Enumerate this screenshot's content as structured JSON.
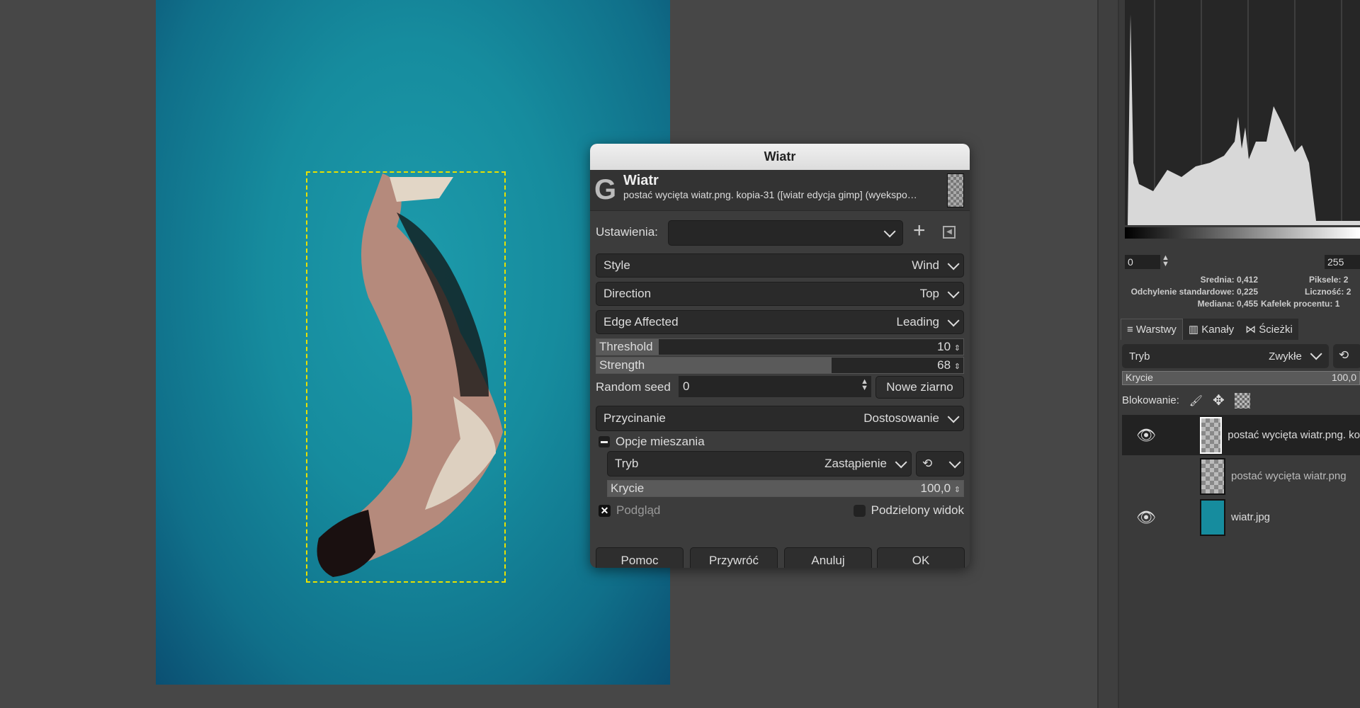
{
  "dialog": {
    "title": "Wiatr",
    "header_title": "Wiatr",
    "header_subtitle": "postać wycięta wiatr.png. kopia-31 ([wiatr edycja gimp] (wyekspo…",
    "presets_label": "Ustawienia:",
    "presets_value": "",
    "style_label": "Style",
    "style_value": "Wind",
    "direction_label": "Direction",
    "direction_value": "Top",
    "edge_label": "Edge Affected",
    "edge_value": "Leading",
    "threshold_label": "Threshold",
    "threshold_value": "10",
    "threshold_fraction": 0.1,
    "strength_label": "Strength",
    "strength_value": "68",
    "strength_fraction": 0.68,
    "seed_label": "Random seed",
    "seed_value": "0",
    "new_seed": "Nowe ziarno",
    "clip_label": "Przycinanie",
    "clip_value": "Dostosowanie",
    "blend_options": "Opcje mieszania",
    "mode_label": "Tryb",
    "mode_value": "Zastąpienie",
    "opacity_label": "Krycie",
    "opacity_value": "100,0",
    "preview_label": "Podgląd",
    "preview_checked": true,
    "split_label": "Podzielony widok",
    "split_checked": false,
    "buttons": {
      "help": "Pomoc",
      "reset": "Przywróć",
      "cancel": "Anuluj",
      "ok": "OK"
    }
  },
  "histogram": {
    "min": "0",
    "max": "255",
    "stats_left": [
      {
        "label": "Srednia:",
        "value": "0,412"
      },
      {
        "label": "Odchylenie standardowe:",
        "value": "0,225"
      },
      {
        "label": "Mediana:",
        "value": "0,455"
      }
    ],
    "stats_right": [
      {
        "label": "Piksele:",
        "value": "2"
      },
      {
        "label": "Liczność:",
        "value": "2"
      },
      {
        "label": "Kafelek procentu:",
        "value": "1"
      }
    ]
  },
  "layers_panel": {
    "tabs": [
      "Warstwy",
      "Kanały",
      "Ścieżki"
    ],
    "mode_label": "Tryb",
    "mode_value": "Zwykłe",
    "opacity_label": "Krycie",
    "opacity_value": "100,0",
    "lock_label": "Blokowanie:",
    "layers": [
      {
        "name": "postać wycięta wiatr.png. ko",
        "visible": true
      },
      {
        "name": "postać wycięta wiatr.png",
        "visible": false
      },
      {
        "name": "wiatr.jpg",
        "visible": true
      }
    ]
  }
}
